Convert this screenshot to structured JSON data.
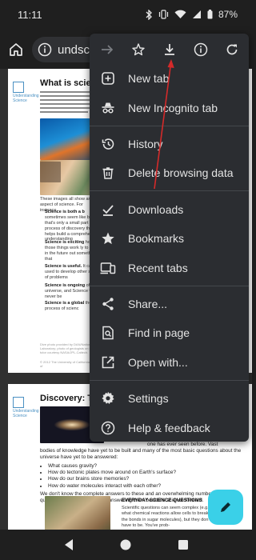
{
  "status": {
    "time": "11:11",
    "battery": "87%"
  },
  "toolbar": {
    "url": "undsci.be"
  },
  "doc1": {
    "title": "What is scienc",
    "logo": "Understanding Science",
    "paragraph": "The word \"science\" probably brings to mind many different pictures: a fat textbook, white lab coats and microscopes, an astronomer peering through a telescope, a naturalist in the rainforest, Einstein's equations scribbled on a chalkboard, the launch of the space shuttle, bubbling beakers ... All of those images reflect some aspect of science, but none of them provides a full picture",
    "caption": "These images all show an aspect of science. For instance,",
    "bullets": [
      {
        "bold": "Science is both a b",
        "text": "sometimes seem like but that's only a small part the process of discovery that helps build a comprehensive understanding"
      },
      {
        "bold": "Science is exciting",
        "text": "how those things work ly to work in the future out something that"
      },
      {
        "bold": "Science is useful.",
        "text": "It can be used to develop other sorts of problems"
      },
      {
        "bold": "Science is ongoing",
        "text": "of the universe, and Science will never be"
      },
      {
        "bold": "Science is a global",
        "text": "the process of scienc"
      }
    ],
    "footer1": "Dive photo provided by DAN/National Laboratory; photo of geologists on outcrop tutor courtesy NASA/JPL-Caltech.",
    "footer2": "© 2012 The University of California Museum of"
  },
  "doc2": {
    "title": "Discovery: Th",
    "logo": "Understanding Science",
    "tail": "one has ever seen before. Vast",
    "paragraph": "bodies of knowledge have yet to be built and many of the most basic questions about the universe have yet to be answered:",
    "questions": [
      "What causes gravity?",
      "How do tectonic plates move around on Earth's surface?",
      "How do our brains store memories?",
      "How do water molecules interact with each other?"
    ],
    "closing": "We don't know the complete answers to these and an overwhelming number of other questions, but the prospect of answering them beckons science forward.",
    "evq_title": "EVERYDAY SCIENCE QUESTIONS",
    "evq_text": "Scientific questions can seem complex (e.g., what chemical reactions allow cells to break the bonds in sugar molecules), but they don't have to be. You've prob-"
  },
  "menu": {
    "items": [
      {
        "label": "New tab",
        "icon": "new-tab-icon"
      },
      {
        "label": "New Incognito tab",
        "icon": "incognito-icon"
      },
      {
        "label": "History",
        "icon": "history-icon"
      },
      {
        "label": "Delete browsing data",
        "icon": "trash-icon"
      },
      {
        "label": "Downloads",
        "icon": "downloads-icon"
      },
      {
        "label": "Bookmarks",
        "icon": "star-icon"
      },
      {
        "label": "Recent tabs",
        "icon": "recent-tabs-icon"
      },
      {
        "label": "Share...",
        "icon": "share-icon"
      },
      {
        "label": "Find in page",
        "icon": "find-in-page-icon"
      },
      {
        "label": "Open with...",
        "icon": "open-with-icon"
      },
      {
        "label": "Settings",
        "icon": "gear-icon"
      },
      {
        "label": "Help & feedback",
        "icon": "help-icon"
      }
    ]
  },
  "colors": {
    "menu_bg": "#2b2d31",
    "fab": "#3ad0e8",
    "arrow": "#d42a2a"
  }
}
